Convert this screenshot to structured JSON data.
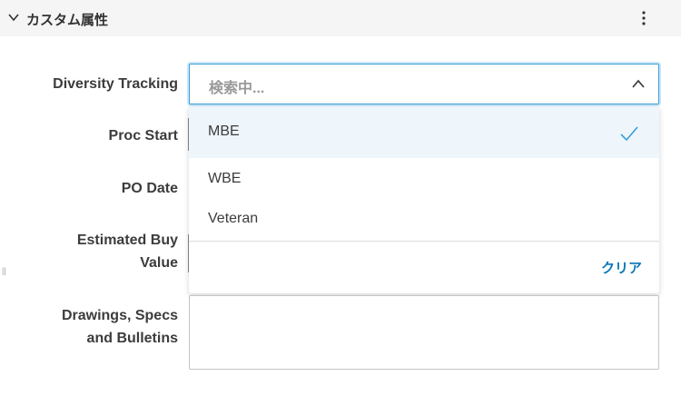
{
  "section": {
    "title": "カスタム属性"
  },
  "fields": [
    {
      "label": "Diversity Tracking"
    },
    {
      "label": "Proc Start"
    },
    {
      "label": "PO Date"
    },
    {
      "label_line1": "Estimated Buy",
      "label_line2": "Value"
    },
    {
      "label_line1": "Drawings, Specs",
      "label_line2": "and Bulletins"
    }
  ],
  "select": {
    "placeholder": "検索中..."
  },
  "dropdown": {
    "options": [
      {
        "label": "MBE",
        "selected": true
      },
      {
        "label": "WBE"
      },
      {
        "label": "Veteran"
      }
    ],
    "clear_label": "クリア"
  },
  "colors": {
    "accent": "#0a76b8",
    "focus": "#3a9fd8",
    "highlight": "#eef5fb"
  }
}
